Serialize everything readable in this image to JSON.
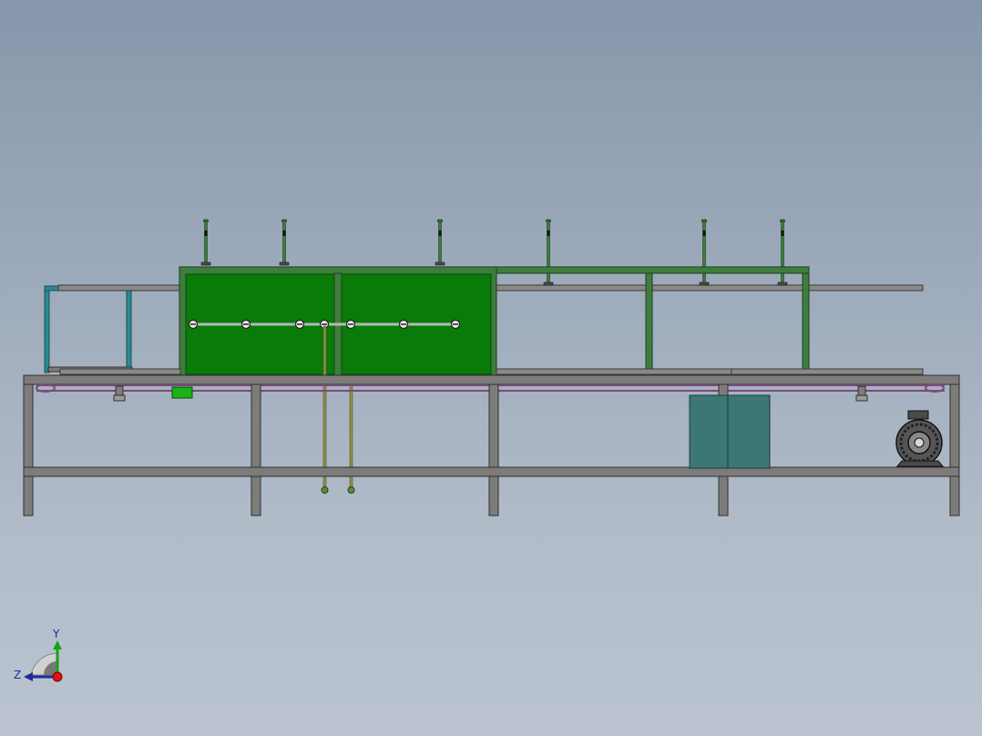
{
  "colors": {
    "background_top": "#8797ab",
    "background_bottom": "#bac3cf",
    "frame": "#7d7c7a",
    "frame_edge": "#303030",
    "tank": "#087b08",
    "tank_frame": "#3e7d3e",
    "cabinet": "#3b7775",
    "rail": "#2a8a93",
    "pipe": "#8f8f46",
    "belt": "#7b4a7b"
  },
  "triad": {
    "y_label": "Y",
    "z_label": "Z",
    "x_icon": "red-dot-x-axis",
    "y_icon": "green-arrow-y-axis",
    "z_icon": "blue-arrow-z-axis"
  },
  "parts": {
    "nozzle_count": 7,
    "top_sensor_count": 6,
    "leg_count": 5,
    "idler_count": 2,
    "motor_icon": "electric-motor-icon"
  }
}
